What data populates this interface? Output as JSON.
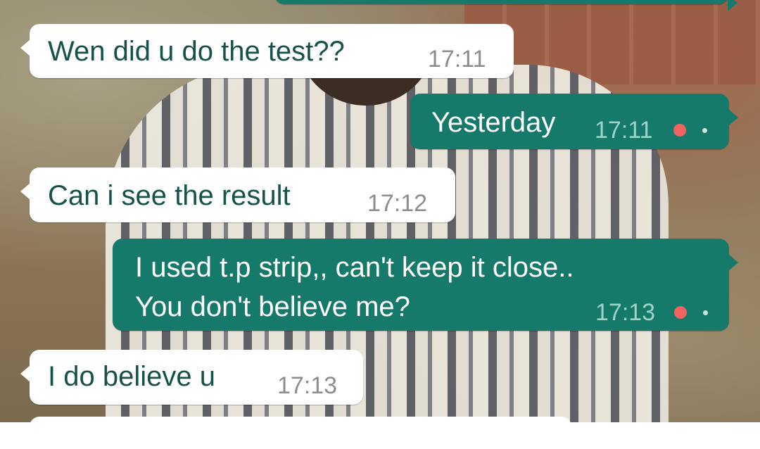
{
  "chat": {
    "messages": [
      {
        "direction": "incoming",
        "text": "Wen did u do the test??",
        "time": "17:11"
      },
      {
        "direction": "outgoing",
        "text": "Yesterday",
        "time": "17:11"
      },
      {
        "direction": "incoming",
        "text": "Can i see the result",
        "time": "17:12"
      },
      {
        "direction": "outgoing",
        "lines": [
          "I used t.p strip,, can't keep it close..",
          "You don't believe me?"
        ],
        "time": "17:13"
      },
      {
        "direction": "incoming",
        "text": "I do believe u",
        "time": "17:13"
      }
    ]
  },
  "colors": {
    "incoming_bubble": "#ffffff",
    "incoming_text": "#17524a",
    "outgoing_bubble": "#167a6a",
    "outgoing_text": "#ffffff",
    "status_indicator": "#f0635f"
  }
}
